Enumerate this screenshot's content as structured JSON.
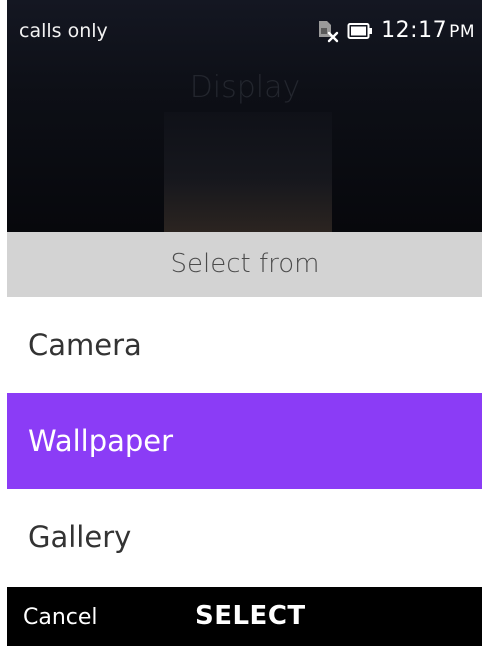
{
  "status_bar": {
    "carrier_text": "calls only",
    "time": "12:17",
    "ampm": "PM",
    "icons": [
      "no-sim-icon",
      "battery-icon"
    ]
  },
  "background_app": {
    "title": "Display"
  },
  "menu": {
    "header": "Select from",
    "items": [
      {
        "label": "Camera",
        "selected": false
      },
      {
        "label": "Wallpaper",
        "selected": true
      },
      {
        "label": "Gallery",
        "selected": false
      }
    ],
    "highlight_color": "#8b3cf6"
  },
  "softkeys": {
    "left": "Cancel",
    "center": "SELECT",
    "right": ""
  }
}
